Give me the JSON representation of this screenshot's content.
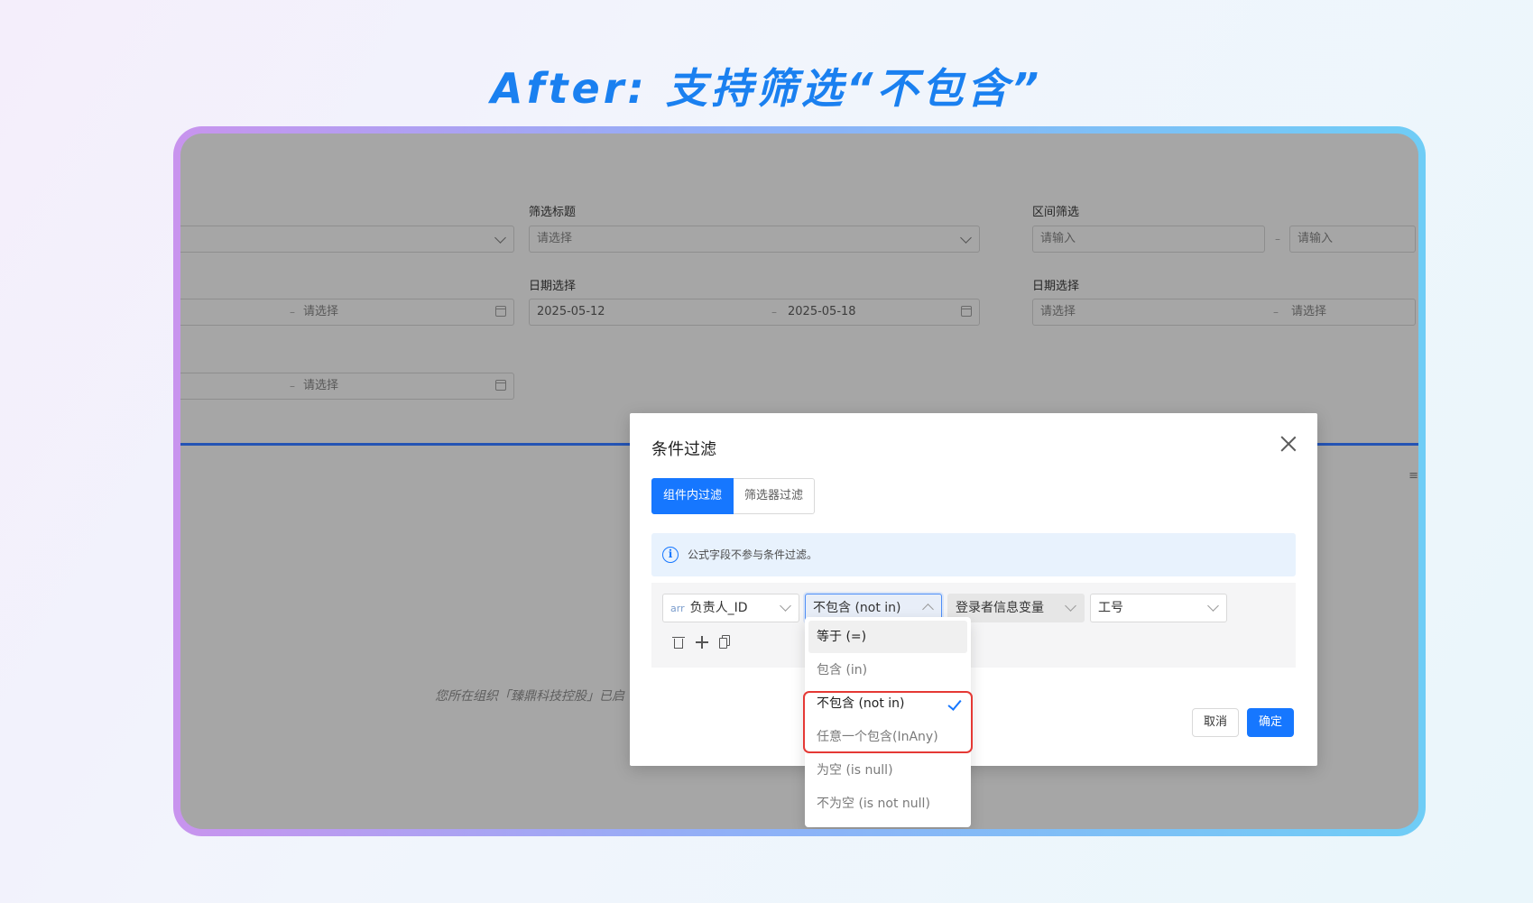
{
  "headline": "After: 支持筛选“不包含”",
  "background_form": {
    "filter_title_label": "筛选标题",
    "filter_title_placeholder": "请选择",
    "range_label": "区间筛选",
    "range_from_placeholder": "请输入",
    "range_to_placeholder": "请输入",
    "date_label_1": "日期选择",
    "date_1_start": "2025-05-12",
    "date_1_end": "2025-05-18",
    "date_label_2": "日期选择",
    "date_2_start_placeholder": "请选择",
    "date_2_end_placeholder": "请选择",
    "left_date_end_placeholder": "请选择",
    "left_date2_end_placeholder": "请选择",
    "note": "您所在组织「臻鼎科技控股」已启"
  },
  "modal": {
    "title": "条件过滤",
    "tabs": [
      "组件内过滤",
      "筛选器过滤"
    ],
    "info": "公式字段不参与条件过滤。",
    "condition": {
      "field_type_tag": "arr",
      "field": "负责人_ID",
      "operator": "不包含 (not in)",
      "value_source": "登录者信息变量",
      "value_field": "工号"
    },
    "cancel_label": "取消",
    "ok_label": "确定"
  },
  "operator_options": [
    "等于 (=)",
    "包含 (in)",
    "不包含 (not in)",
    "任意一个包含(InAny)",
    "为空 (is null)",
    "不为空 (is not null)"
  ],
  "selected_operator": "不包含 (not in)",
  "colors": {
    "accent": "#1677ff",
    "headline": "#1a80f0",
    "highlight_box": "#e53935"
  }
}
